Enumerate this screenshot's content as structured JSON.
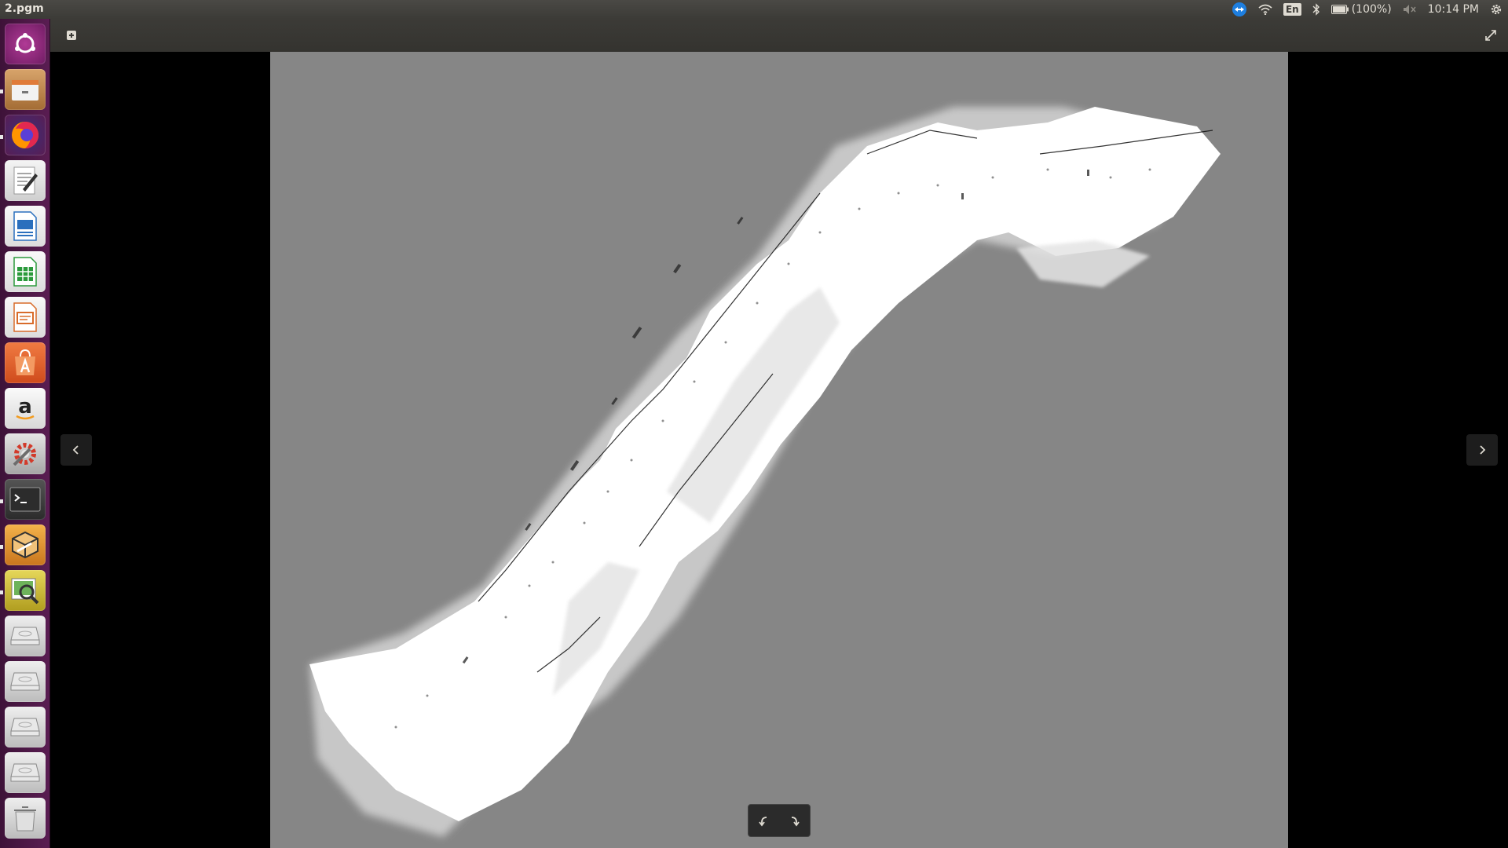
{
  "window": {
    "title": "2.pgm"
  },
  "panel": {
    "keyboard_layout": "En",
    "battery_text": "(100%)",
    "clock": "10:14 PM"
  },
  "launcher": {
    "items": [
      {
        "name": "ubuntu-dash",
        "color": "#9b2b86"
      },
      {
        "name": "files",
        "color": "#c9905a"
      },
      {
        "name": "firefox",
        "color": "#e66000"
      },
      {
        "name": "text-editor",
        "color": "#d9d9d9"
      },
      {
        "name": "libreoffice-writer",
        "color": "#2a6fbd"
      },
      {
        "name": "libreoffice-calc",
        "color": "#2b9a3c"
      },
      {
        "name": "libreoffice-impress",
        "color": "#d86b2a"
      },
      {
        "name": "ubuntu-software",
        "color": "#e0632d"
      },
      {
        "name": "amazon",
        "color": "#f1f1f1"
      },
      {
        "name": "system-settings",
        "color": "#c8402e"
      },
      {
        "name": "terminal",
        "color": "#2d2d2d"
      },
      {
        "name": "box-app",
        "color": "#e2962b"
      },
      {
        "name": "image-viewer",
        "color": "#d3c63c"
      },
      {
        "name": "drive",
        "color": "#cfcfcf"
      },
      {
        "name": "drive",
        "color": "#cfcfcf"
      },
      {
        "name": "drive",
        "color": "#cfcfcf"
      },
      {
        "name": "drive",
        "color": "#cfcfcf"
      },
      {
        "name": "trash",
        "color": "#cfcfcf"
      }
    ]
  },
  "viewer": {
    "image_background": "#868686"
  }
}
